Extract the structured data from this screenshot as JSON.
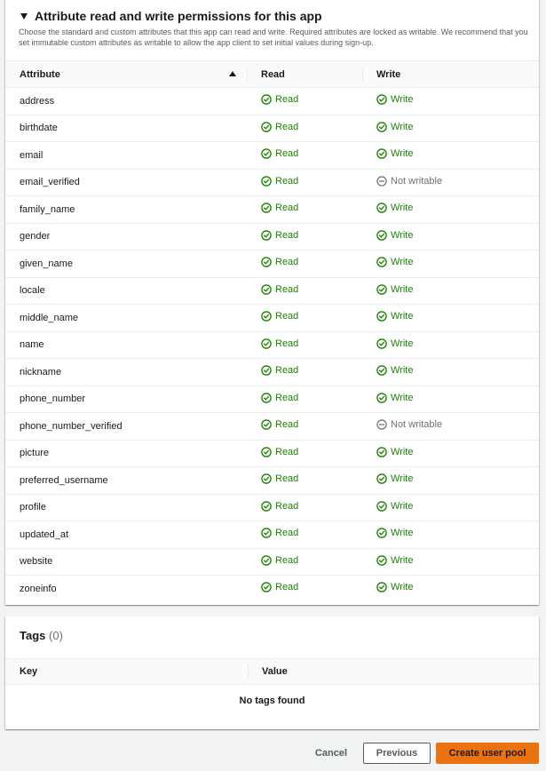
{
  "attributes_section": {
    "title": "Attribute read and write permissions for this app",
    "description": "Choose the standard and custom attributes that this app can read and write. Required attributes are locked as writable. We recommend that you set immutable custom attributes as writable to allow the app client to set initial values during sign-up.",
    "columns": {
      "attribute": "Attribute",
      "read": "Read",
      "write": "Write"
    },
    "rows": [
      {
        "name": "address",
        "read": "Read",
        "write": "Write",
        "writable": true
      },
      {
        "name": "birthdate",
        "read": "Read",
        "write": "Write",
        "writable": true
      },
      {
        "name": "email",
        "read": "Read",
        "write": "Write",
        "writable": true
      },
      {
        "name": "email_verified",
        "read": "Read",
        "write": "Not writable",
        "writable": false
      },
      {
        "name": "family_name",
        "read": "Read",
        "write": "Write",
        "writable": true
      },
      {
        "name": "gender",
        "read": "Read",
        "write": "Write",
        "writable": true
      },
      {
        "name": "given_name",
        "read": "Read",
        "write": "Write",
        "writable": true
      },
      {
        "name": "locale",
        "read": "Read",
        "write": "Write",
        "writable": true
      },
      {
        "name": "middle_name",
        "read": "Read",
        "write": "Write",
        "writable": true
      },
      {
        "name": "name",
        "read": "Read",
        "write": "Write",
        "writable": true
      },
      {
        "name": "nickname",
        "read": "Read",
        "write": "Write",
        "writable": true
      },
      {
        "name": "phone_number",
        "read": "Read",
        "write": "Write",
        "writable": true
      },
      {
        "name": "phone_number_verified",
        "read": "Read",
        "write": "Not writable",
        "writable": false
      },
      {
        "name": "picture",
        "read": "Read",
        "write": "Write",
        "writable": true
      },
      {
        "name": "preferred_username",
        "read": "Read",
        "write": "Write",
        "writable": true
      },
      {
        "name": "profile",
        "read": "Read",
        "write": "Write",
        "writable": true
      },
      {
        "name": "updated_at",
        "read": "Read",
        "write": "Write",
        "writable": true
      },
      {
        "name": "website",
        "read": "Read",
        "write": "Write",
        "writable": true
      },
      {
        "name": "zoneinfo",
        "read": "Read",
        "write": "Write",
        "writable": true
      }
    ]
  },
  "tags_section": {
    "title": "Tags",
    "count": "(0)",
    "columns": {
      "key": "Key",
      "value": "Value"
    },
    "empty_text": "No tags found"
  },
  "actions": {
    "cancel": "Cancel",
    "previous": "Previous",
    "create": "Create user pool"
  },
  "icons": {
    "status_ok": "check-circle-icon",
    "status_na": "minus-circle-icon",
    "sort": "sort-ascending-icon",
    "expand": "caret-down-icon"
  },
  "colors": {
    "success": "#1d8102",
    "disabled": "#687078",
    "primary_button": "#ec7211"
  }
}
